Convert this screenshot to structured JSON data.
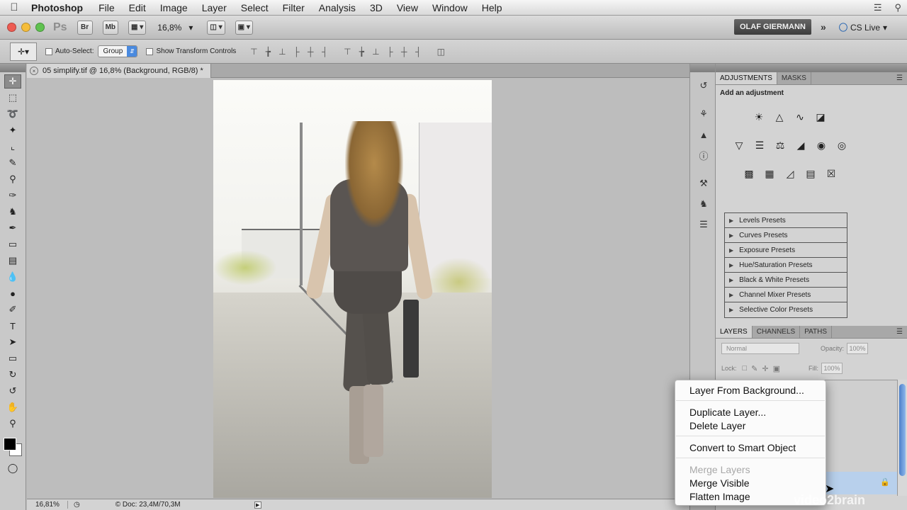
{
  "menubar": {
    "apple": "",
    "app_name": "Photoshop",
    "items": [
      "File",
      "Edit",
      "Image",
      "Layer",
      "Select",
      "Filter",
      "Analysis",
      "3D",
      "View",
      "Window",
      "Help"
    ],
    "volume_icon": "volume-icon",
    "search_icon": "spotlight-search-icon"
  },
  "appbar": {
    "ps_logo": "Ps",
    "bridge": "Br",
    "minibridge": "Mb",
    "zoom": "16,8%",
    "workspace": "OLAF GIERMANN",
    "more": "»",
    "cslive": "CS Live"
  },
  "options": {
    "auto_select": "Auto-Select:",
    "group_value": "Group",
    "show_transform": "Show Transform Controls"
  },
  "document": {
    "tab_title": "05 simplify.tif @ 16,8% (Background, RGB/8) *",
    "close": "×"
  },
  "statusbar": {
    "zoom": "16,81%",
    "doc": "© Doc: 23,4M/70,3M",
    "arrow": "▶"
  },
  "adjustments": {
    "tabs": [
      "ADJUSTMENTS",
      "MASKS"
    ],
    "title": "Add an adjustment",
    "presets": [
      "Levels Presets",
      "Curves Presets",
      "Exposure Presets",
      "Hue/Saturation Presets",
      "Black & White Presets",
      "Channel Mixer Presets",
      "Selective Color Presets"
    ]
  },
  "layers": {
    "tabs": [
      "LAYERS",
      "CHANNELS",
      "PATHS"
    ],
    "blend_mode": "Normal",
    "opacity_label": "Opacity:",
    "opacity": "100%",
    "lock_label": "Lock:",
    "fill_label": "Fill:",
    "fill": "100%"
  },
  "context_menu": {
    "items": [
      {
        "label": "Layer From Background...",
        "enabled": true
      },
      {
        "label": "Duplicate Layer...",
        "enabled": true
      },
      {
        "label": "Delete Layer",
        "enabled": true
      },
      {
        "label": "Convert to Smart Object",
        "enabled": true
      },
      {
        "label": "Merge Layers",
        "enabled": false
      },
      {
        "label": "Merge Visible",
        "enabled": true
      },
      {
        "label": "Flatten Image",
        "enabled": true
      }
    ]
  },
  "watermark": "video2brain",
  "colors": {
    "foreground": "#000000",
    "background": "#ffffff",
    "selection": "#b8d0ec"
  }
}
